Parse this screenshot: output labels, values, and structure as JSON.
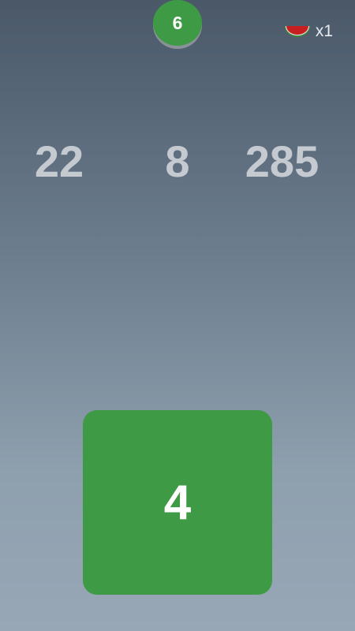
{
  "score": {
    "value": "6",
    "color": "#3f9a46"
  },
  "lives": {
    "icon": "watermelon-slice-icon",
    "count_label": "x1"
  },
  "targets": [
    "22",
    "8",
    "285"
  ],
  "tile": {
    "value": "4",
    "color": "#3f9a46"
  }
}
